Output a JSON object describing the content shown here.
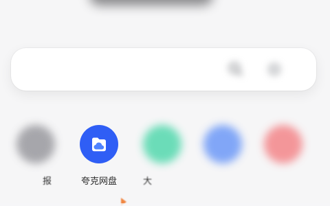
{
  "search": {
    "placeholder": ""
  },
  "apps": [
    {
      "name": "",
      "color": "#8c8c92",
      "label": "报",
      "icon": "gray-app-icon"
    },
    {
      "name": "夸克网盘",
      "color": "#2f5ef5",
      "label": "夸克网盘",
      "icon": "cloud-folder-icon"
    },
    {
      "name": "大",
      "color": "#3dd4a3",
      "label": "大",
      "icon": "green-app-icon"
    },
    {
      "name": "",
      "color": "#5a8cf7",
      "label": "",
      "icon": "blue-app-icon"
    },
    {
      "name": "",
      "color": "#f3767a",
      "label": "",
      "icon": "red-app-icon"
    }
  ],
  "colors": {
    "background": "#f6f6f7",
    "search_bg": "#ffffff"
  }
}
